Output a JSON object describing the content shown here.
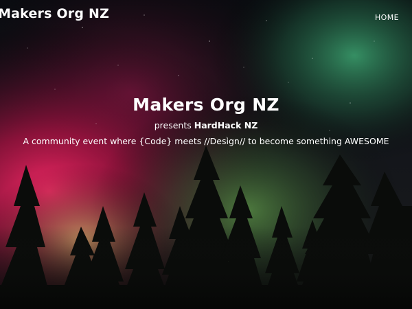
{
  "nav": {
    "brand": "Makers Org NZ",
    "links": [
      {
        "label": "HOME"
      }
    ]
  },
  "hero": {
    "title": "Makers Org NZ",
    "subtitle_prefix": "presents",
    "subtitle_event": "HardHack NZ",
    "tagline": "A community event where {Code} meets //Design// to become something AWESOME"
  },
  "background": {
    "description_icon": "aurora-forest-photo-icon",
    "colors": {
      "sky_dark": "#0b0d12",
      "aurora_magenta": "#d0215a",
      "aurora_green": "#3fc47c"
    }
  }
}
